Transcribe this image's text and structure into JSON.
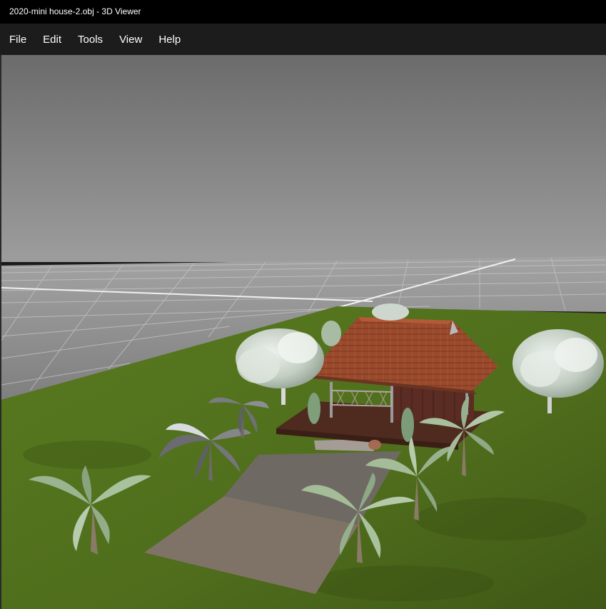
{
  "window": {
    "title": "2020-mini house-2.obj - 3D Viewer"
  },
  "menu": {
    "items": [
      {
        "label": "File",
        "name": "menu-file"
      },
      {
        "label": "Edit",
        "name": "menu-edit"
      },
      {
        "label": "Tools",
        "name": "menu-tools"
      },
      {
        "label": "View",
        "name": "menu-view"
      },
      {
        "label": "Help",
        "name": "menu-help"
      }
    ]
  },
  "scene": {
    "model": "2020-mini house-2.obj",
    "colors": {
      "sky_top": "#6e6e6e",
      "sky_bottom": "#9a9a9a",
      "grid_floor": "#8c8c8c",
      "grid_line": "#c8c8c8",
      "grass": "#5b7a22",
      "grass_dark": "#46611a",
      "path": "#7e7369",
      "roof": "#9b4b2e",
      "wood": "#5a2e22",
      "foliage": "#c9d4c9",
      "palm": "#8fae8a"
    }
  }
}
